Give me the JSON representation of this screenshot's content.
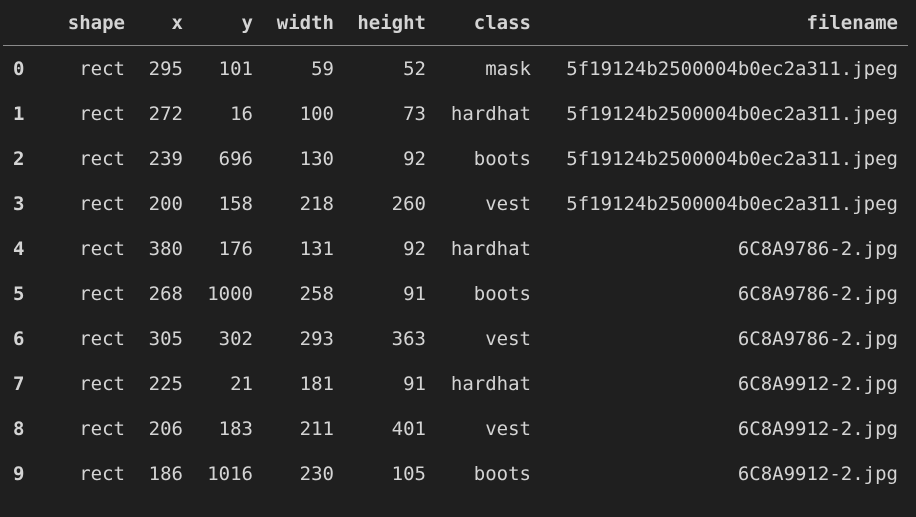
{
  "table": {
    "columns": [
      "",
      "shape",
      "x",
      "y",
      "width",
      "height",
      "class",
      "filename"
    ],
    "rows": [
      {
        "index": "0",
        "shape": "rect",
        "x": "295",
        "y": "101",
        "width": "59",
        "height": "52",
        "class": "mask",
        "filename": "5f19124b2500004b0ec2a311.jpeg"
      },
      {
        "index": "1",
        "shape": "rect",
        "x": "272",
        "y": "16",
        "width": "100",
        "height": "73",
        "class": "hardhat",
        "filename": "5f19124b2500004b0ec2a311.jpeg"
      },
      {
        "index": "2",
        "shape": "rect",
        "x": "239",
        "y": "696",
        "width": "130",
        "height": "92",
        "class": "boots",
        "filename": "5f19124b2500004b0ec2a311.jpeg"
      },
      {
        "index": "3",
        "shape": "rect",
        "x": "200",
        "y": "158",
        "width": "218",
        "height": "260",
        "class": "vest",
        "filename": "5f19124b2500004b0ec2a311.jpeg"
      },
      {
        "index": "4",
        "shape": "rect",
        "x": "380",
        "y": "176",
        "width": "131",
        "height": "92",
        "class": "hardhat",
        "filename": "6C8A9786-2.jpg"
      },
      {
        "index": "5",
        "shape": "rect",
        "x": "268",
        "y": "1000",
        "width": "258",
        "height": "91",
        "class": "boots",
        "filename": "6C8A9786-2.jpg"
      },
      {
        "index": "6",
        "shape": "rect",
        "x": "305",
        "y": "302",
        "width": "293",
        "height": "363",
        "class": "vest",
        "filename": "6C8A9786-2.jpg"
      },
      {
        "index": "7",
        "shape": "rect",
        "x": "225",
        "y": "21",
        "width": "181",
        "height": "91",
        "class": "hardhat",
        "filename": "6C8A9912-2.jpg"
      },
      {
        "index": "8",
        "shape": "rect",
        "x": "206",
        "y": "183",
        "width": "211",
        "height": "401",
        "class": "vest",
        "filename": "6C8A9912-2.jpg"
      },
      {
        "index": "9",
        "shape": "rect",
        "x": "186",
        "y": "1016",
        "width": "230",
        "height": "105",
        "class": "boots",
        "filename": "6C8A9912-2.jpg"
      }
    ]
  }
}
